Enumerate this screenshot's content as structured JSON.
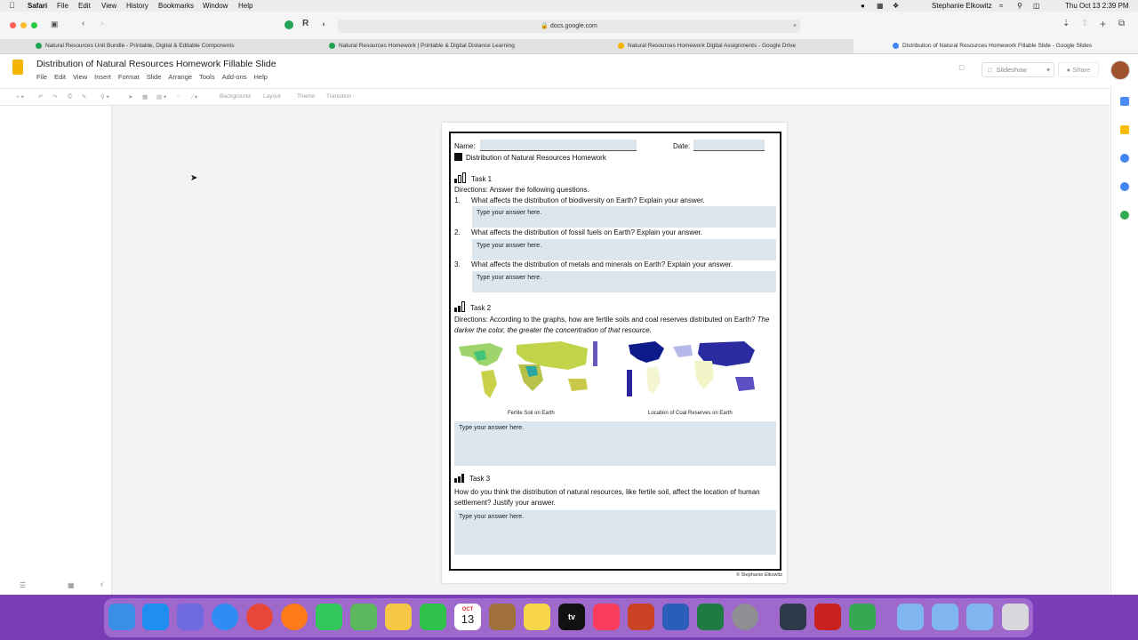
{
  "menubar": {
    "app": "Safari",
    "items": [
      "File",
      "Edit",
      "View",
      "History",
      "Bookmarks",
      "Window",
      "Help"
    ],
    "user": "Stephanie Elkowitz",
    "datetime": "Thu Oct 13  2:39 PM"
  },
  "browser": {
    "url": "docs.google.com",
    "tabs": [
      {
        "title": "Natural Resources Unit Bundle - Printable, Digital & Editable Components"
      },
      {
        "title": "Natural Resources Homework | Printable & Digital Distance Learning"
      },
      {
        "title": "Natural Resources Homework Digital Assignments - Google Drive"
      },
      {
        "title": "Distribution of Natural Resources Homework Fillable Slide - Google Slides"
      }
    ]
  },
  "slides": {
    "title": "Distribution of Natural Resources Homework Fillable Slide",
    "menus": [
      "File",
      "Edit",
      "View",
      "Insert",
      "Format",
      "Slide",
      "Arrange",
      "Tools",
      "Add-ons",
      "Help"
    ],
    "toolbar": {
      "background": "Background",
      "layout": "Layout",
      "theme": "Theme",
      "transition": "Transition"
    },
    "slideshow": "Slideshow",
    "share": "Share"
  },
  "worksheet": {
    "name_label": "Name:",
    "date_label": "Date:",
    "heading": "Distribution of Natural Resources Homework",
    "task1": {
      "title": "Task 1",
      "directions": "Directions: Answer the following questions.",
      "questions": [
        {
          "num": "1.",
          "text": "What affects the distribution of biodiversity on Earth? Explain your answer."
        },
        {
          "num": "2.",
          "text": "What affects the distribution of fossil fuels on Earth? Explain your answer."
        },
        {
          "num": "3.",
          "text": "What affects the distribution of metals and minerals on Earth? Explain your answer."
        }
      ],
      "answer_placeholder": "Type your answer here."
    },
    "task2": {
      "title": "Task 2",
      "directions": "Directions: According to the graphs, how are fertile soils and coal reserves distributed on Earth?",
      "directions_italic": "The darker the color, the greater the concentration of that resource.",
      "map1_caption": "Fertile Soil on Earth",
      "map2_caption": "Location of Coal Reserves on Earth",
      "answer_placeholder": "Type your answer here."
    },
    "task3": {
      "title": "Task 3",
      "directions": "How do you think the distribution of natural resources, like fertile soil, affect the location of human settlement? Justify your answer.",
      "answer_placeholder": "Type your answer here."
    },
    "copyright": "© Stephanie Elkowitz"
  },
  "dock": {
    "calendar_month": "OCT",
    "calendar_day": "13",
    "tv_label": "tv"
  }
}
